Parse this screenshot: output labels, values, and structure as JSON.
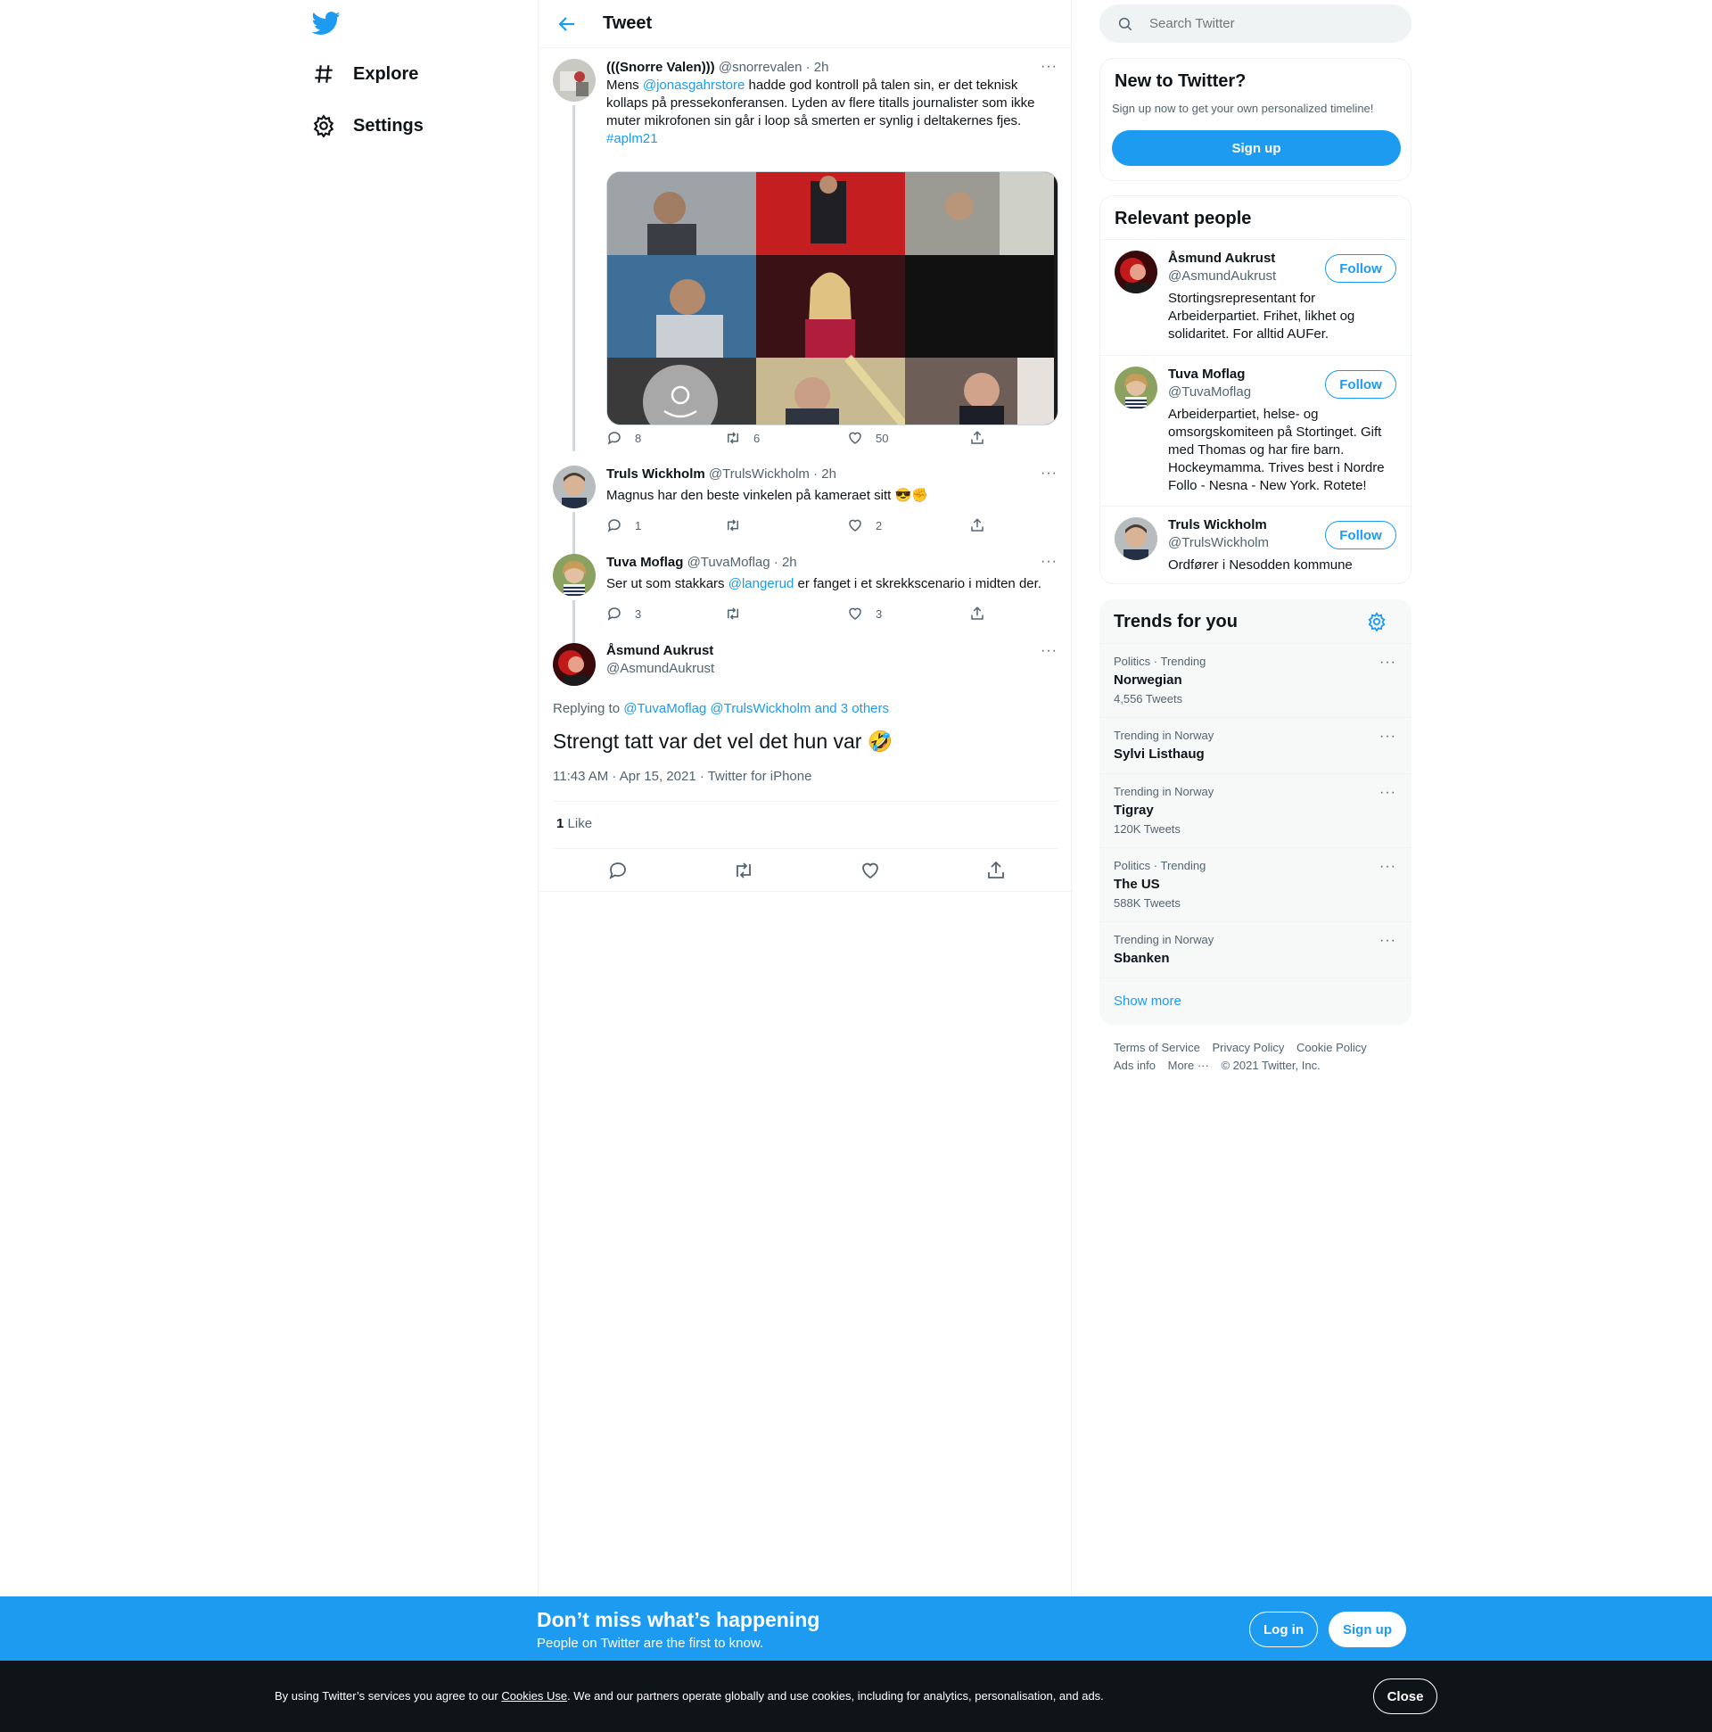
{
  "nav": {
    "logo_icon": "twitter-bird-icon",
    "items": [
      {
        "label": "Explore",
        "icon": "hashtag-icon"
      },
      {
        "label": "Settings",
        "icon": "gear-icon"
      }
    ]
  },
  "header": {
    "title": "Tweet",
    "back_icon": "arrow-left-icon"
  },
  "thread": [
    {
      "name": "(((Snorre Valen)))",
      "handle": "@snorrevalen",
      "time": "· 2h",
      "text_before": "Mens ",
      "mention": "@jonasgahrstore",
      "text_after": " hadde god kontroll på talen sin, er det teknisk kollaps på pressekonferansen. Lyden av flere titalls journalister som ikke muter mikrofonen sin går i loop så smerten er synlig i deltakernes fjes.",
      "hashtag": "#aplm21",
      "replies": "8",
      "retweets": "6",
      "likes": "50"
    },
    {
      "name": "Truls Wickholm",
      "handle": "@TrulsWickholm",
      "time": "· 2h",
      "text": "Magnus har den beste vinkelen på kameraet sitt 😎✊",
      "replies": "1",
      "retweets": "",
      "likes": "2"
    },
    {
      "name": "Tuva Moflag",
      "handle": "@TuvaMoflag",
      "time": "· 2h",
      "text_before": "Ser ut som stakkars ",
      "mention": "@langerud",
      "text_after": " er fanget i et skrekkscenario i midten der.",
      "replies": "3",
      "retweets": "",
      "likes": "3"
    }
  ],
  "main_tweet": {
    "name": "Åsmund Aukrust",
    "handle": "@AsmundAukrust",
    "replying_label": "Replying to",
    "replying_to": "@TuvaMoflag @TrulsWickholm and 3 others",
    "text": "Strengt tatt var det vel det hun var 🤣",
    "timestamp": "11:43 AM · Apr 15, 2021 · Twitter for iPhone",
    "like_count": "1",
    "like_label": "Like"
  },
  "search": {
    "placeholder": "Search Twitter"
  },
  "new_to_twitter": {
    "title": "New to Twitter?",
    "subtitle": "Sign up now to get your own personalized timeline!",
    "button": "Sign up"
  },
  "relevant_people": {
    "title": "Relevant people",
    "follow_label": "Follow",
    "people": [
      {
        "name": "Åsmund Aukrust",
        "handle": "@AsmundAukrust",
        "bio": "Stortingsrepresentant for Arbeiderpartiet. Frihet, likhet og solidaritet. For alltid AUFer."
      },
      {
        "name": "Tuva Moflag",
        "handle": "@TuvaMoflag",
        "bio": "Arbeiderpartiet, helse- og omsorgskomiteen på Stortinget. Gift med Thomas og har fire barn. Hockeymamma. Trives best i Nordre Follo - Nesna - New York. Rotete!"
      },
      {
        "name": "Truls Wickholm",
        "handle": "@TrulsWickholm",
        "bio": "Ordfører i Nesodden kommune"
      }
    ]
  },
  "trends": {
    "title": "Trends for you",
    "items": [
      {
        "context": "Politics · Trending",
        "name": "Norwegian",
        "count": "4,556 Tweets"
      },
      {
        "context": "Trending in Norway",
        "name": "Sylvi Listhaug",
        "count": ""
      },
      {
        "context": "Trending in Norway",
        "name": "Tigray",
        "count": "120K Tweets"
      },
      {
        "context": "Politics · Trending",
        "name": "The US",
        "count": "588K Tweets"
      },
      {
        "context": "Trending in Norway",
        "name": "Sbanken",
        "count": ""
      }
    ],
    "show_more": "Show more"
  },
  "footer": {
    "links": [
      "Terms of Service",
      "Privacy Policy",
      "Cookie Policy",
      "Ads info",
      "More ···"
    ],
    "copyright": "© 2021 Twitter, Inc."
  },
  "bottom_bar": {
    "title": "Don’t miss what’s happening",
    "subtitle": "People on Twitter are the first to know.",
    "login": "Log in",
    "signup": "Sign up"
  },
  "cookie_bar": {
    "text_before": "By using Twitter’s services you agree to our ",
    "link": "Cookies Use",
    "text_after": ". We and our partners operate globally and use cookies, including for analytics, personalisation, and ads.",
    "close": "Close"
  },
  "colors": {
    "accent": "#1d9bf0",
    "text": "#0f1419",
    "secondary": "#536471",
    "cookie_bg": "#0f1419"
  }
}
